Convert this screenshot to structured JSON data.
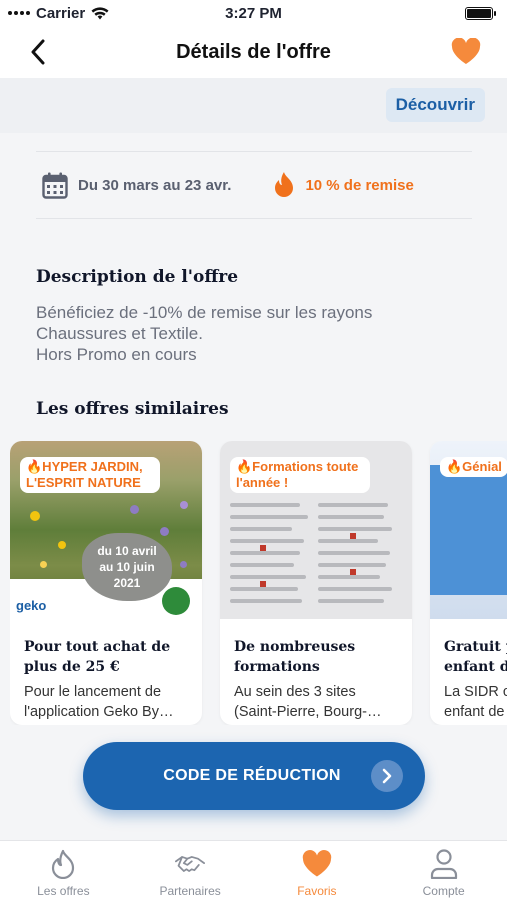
{
  "status_bar": {
    "carrier": "Carrier",
    "time": "3:27 PM"
  },
  "nav": {
    "title": "Détails de  l'offre",
    "favorite_color": "#f58a3c"
  },
  "header": {
    "discover_label": "Découvrir"
  },
  "info": {
    "date": "Du 30 mars au 23 avr.",
    "discount": "10 % de remise"
  },
  "description": {
    "title": "Description de l'offre",
    "lines": [
      "Bénéficiez de -10% de remise sur les rayons",
      "Chaussures et Textile.",
      "Hors Promo en cours"
    ]
  },
  "similar": {
    "title": "Les offres similaires",
    "cards": [
      {
        "tag": "🔥HYPER JARDIN, L'ESPRIT NATURE",
        "image_text": [
          "du 10 avril",
          "au 10 juin",
          "2021"
        ],
        "title": "Pour tout achat de plus de 25 €",
        "desc_lines": [
          "Pour le lancement de",
          "l'application Geko By…"
        ]
      },
      {
        "tag": "🔥Formations toute l'année !",
        "title": "De nombreuses formations",
        "desc_lines": [
          "Au sein des 3 sites",
          "(Saint-Pierre, Bourg-…"
        ]
      },
      {
        "tag": "🔥Génial",
        "title": "Gratuit p… enfant du…",
        "title_lines": [
          "Gratuit p",
          "enfant du"
        ],
        "desc_lines": [
          "La SIDR c",
          "enfant de"
        ]
      }
    ]
  },
  "cta": {
    "label": "CODE DE RÉDUCTION"
  },
  "tabs": [
    {
      "label": "Les offres",
      "icon": "flame-icon"
    },
    {
      "label": "Partenaires",
      "icon": "handshake-icon"
    },
    {
      "label": "Favoris",
      "icon": "heart-icon",
      "active": true
    },
    {
      "label": "Compte",
      "icon": "user-icon"
    }
  ],
  "colors": {
    "primary": "#1c65b0",
    "accent": "#f58a3c"
  }
}
